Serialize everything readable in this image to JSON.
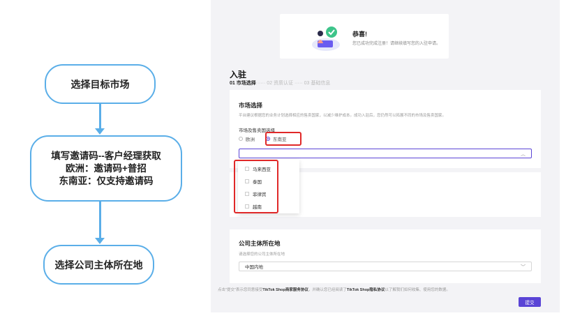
{
  "flowchart": {
    "step1": "选择目标市场",
    "step2": [
      "填写邀请码--客户经理获取",
      "欧洲：邀请码+普招",
      "东南亚：仅支持邀请码"
    ],
    "step3": "选择公司主体所在地",
    "accent_color": "#5aaee8"
  },
  "congrats": {
    "title": "恭喜!",
    "subtitle": "您已成功完成注册！请继续填写您的入驻申请。",
    "icon": "check-icon"
  },
  "page": {
    "title": "入驻",
    "steps": [
      "01 市场选择",
      "02 资质认证",
      "03 基础信息"
    ],
    "step_separator": "·····"
  },
  "market": {
    "title": "市场选择",
    "description": "平台建议根据您的业务计划选择相应的售卖国家，以减少维护成本。成功入驻后，您仍然可以拓展不同的市场及售卖国家。",
    "field_label": "市场及售卖国选择",
    "options": [
      "欧洲",
      "东南亚"
    ],
    "selected": "东南亚",
    "country_select_value": "",
    "dropdown_items": [
      "马来西亚",
      "泰国",
      "菲律宾",
      "越南"
    ]
  },
  "company": {
    "title": "公司主体所在地",
    "description": "请选择您的公司主体所在地",
    "value": "中国内地"
  },
  "footer": {
    "pre": "点击\"提交\"表示您同意接受",
    "link1": "TikTok Shop商家服务协议",
    "mid": "，并确认您已经阅读了",
    "link2": "TikTok Shop隐私协议",
    "post": "以了解我们如何收集、使用您的数据。"
  },
  "submit_label": "提交",
  "brand_color": "#5a44d6",
  "highlight_color": "#e02828"
}
